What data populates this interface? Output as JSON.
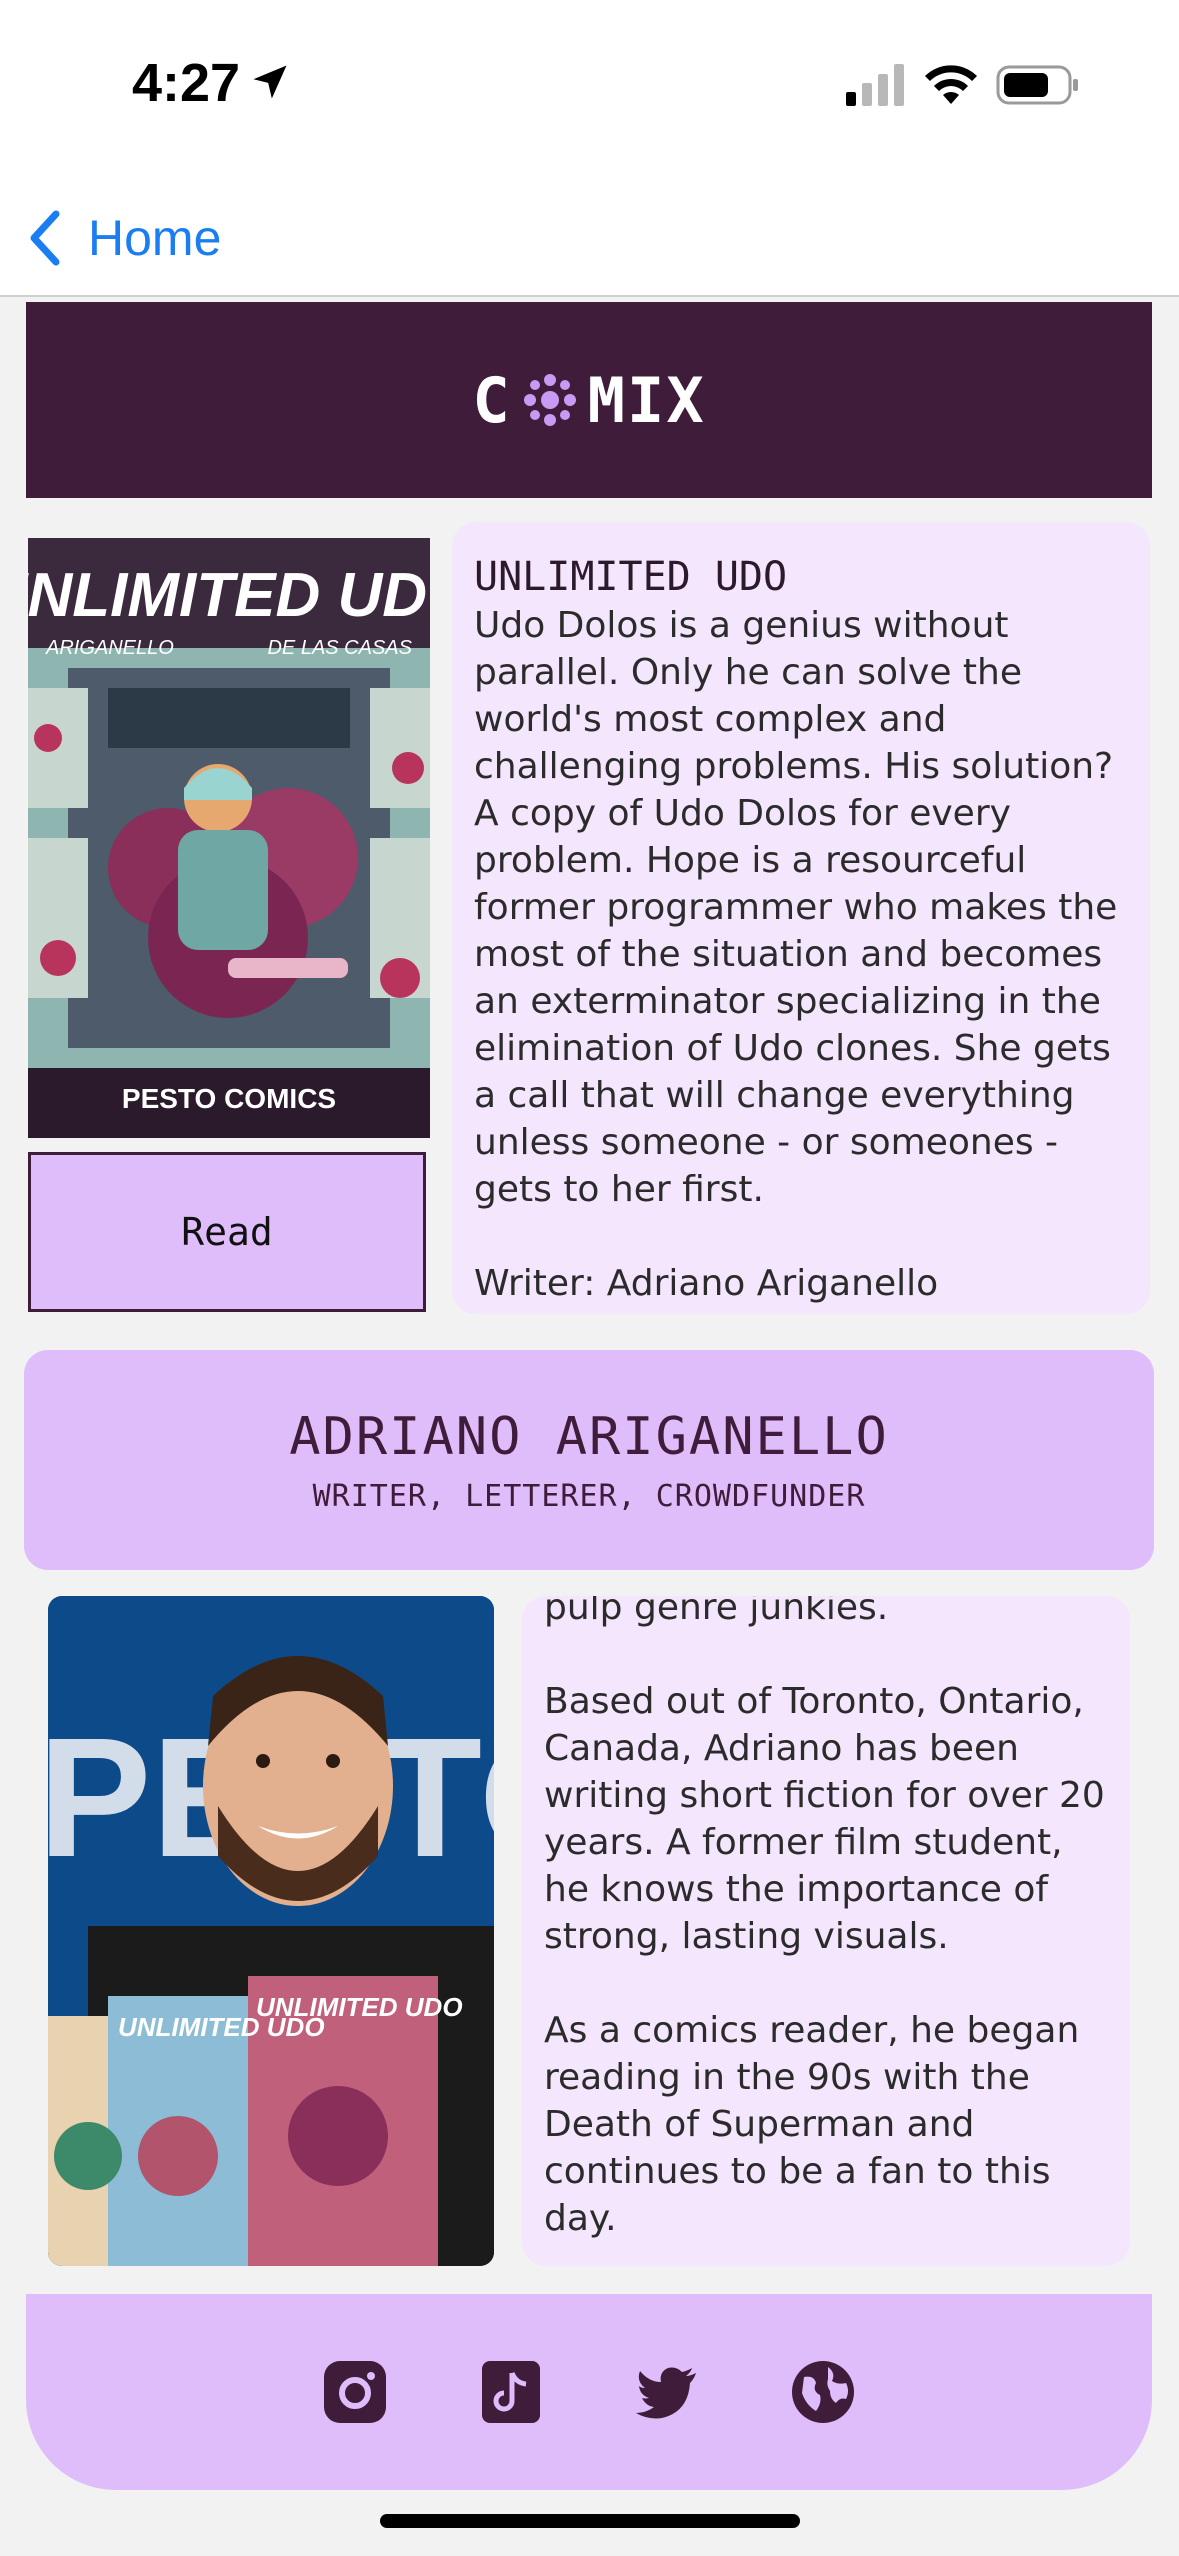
{
  "status_bar": {
    "time": "4:27",
    "location_icon": "location-arrow-icon",
    "signal_icon": "cellular-signal-icon",
    "wifi_icon": "wifi-icon",
    "battery_icon": "battery-icon"
  },
  "nav": {
    "back_label": "Home",
    "back_icon": "chevron-left-icon"
  },
  "header": {
    "logo_left": "C",
    "logo_right": "MIX",
    "logo_icon": "bubble-cluster-icon"
  },
  "comic": {
    "cover": {
      "title": "UNLIMITED UDO",
      "writer": "ARIGANELLO",
      "artist": "DE LAS CASAS",
      "publisher": "PESTO COMICS"
    },
    "read_label": "Read",
    "title": "UNLIMITED UDO",
    "synopsis": "Udo Dolos is a genius without parallel. Only he can solve the world's most complex and challenging problems. His solution? A copy of Udo Dolos for every problem. Hope is a resourceful former programmer who makes the most of the situation and becomes an exterminator specializing in the elimination of Udo clones. She gets a call that will change everything unless someone - or someones - gets to her first.\n\nWriter: Adriano Ariganello\nArtist: Valentin de las Casas"
  },
  "creator": {
    "name": "ADRIANO ARIGANELLO",
    "roles": "WRITER, LETTERER, CROWDFUNDER",
    "bio": "pulp genre junkies.\n\nBased out of Toronto, Ontario, Canada, Adriano has been writing short fiction for over 20 years. A former film student, he knows the importance of strong, lasting visuals.\n\nAs a comics reader, he began reading in the 90s with the Death of Superman and continues to be a fan to this day.",
    "photo": {
      "backdrop_text": "PESTO",
      "book_title": "UNLIMITED UDO"
    }
  },
  "footer": {
    "social": [
      {
        "icon": "instagram-icon"
      },
      {
        "icon": "tiktok-icon"
      },
      {
        "icon": "twitter-icon"
      },
      {
        "icon": "globe-icon"
      }
    ]
  },
  "colors": {
    "accent_dark": "#3f1c3a",
    "lavender": "#dfbdfb",
    "light_lavender": "#f4e6fd",
    "ios_blue": "#1a7df2"
  }
}
